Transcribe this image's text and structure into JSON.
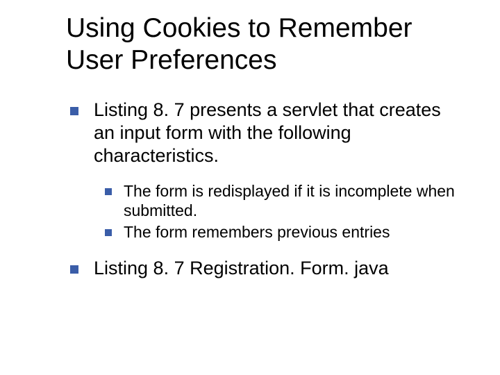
{
  "title": "Using Cookies to Remember User Preferences",
  "bullets": [
    {
      "text": "Listing 8. 7 presents a servlet that creates an input form with the following characteristics.",
      "sub": [
        {
          "text": "The form is redisplayed if it is incomplete when submitted."
        },
        {
          "text": "The form remembers previous entries"
        }
      ]
    },
    {
      "text": "Listing 8. 7 Registration. Form. java",
      "sub": []
    }
  ]
}
